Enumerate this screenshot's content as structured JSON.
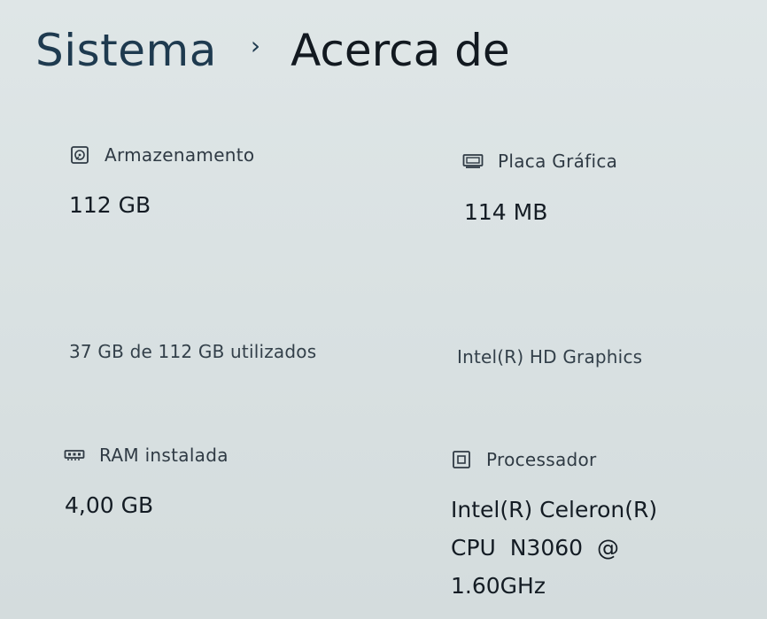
{
  "breadcrumb": {
    "parent": "Sistema",
    "separator": "›",
    "current": "Acerca de"
  },
  "cards": {
    "storage": {
      "icon": "storage-icon",
      "label": "Armazenamento",
      "value": "112 GB",
      "detail": "37 GB de 112 GB utilizados"
    },
    "graphics": {
      "icon": "graphics-card-icon",
      "label": "Placa Gráfica",
      "value": "114 MB",
      "detail": "Intel(R) HD Graphics"
    },
    "ram": {
      "icon": "memory-icon",
      "label": "RAM instalada",
      "value": "4,00 GB"
    },
    "processor": {
      "icon": "processor-icon",
      "label": "Processador",
      "value_lines": [
        "Intel(R) Celeron(R)",
        "CPU  N3060  @",
        "1.60GHz"
      ]
    }
  },
  "colors": {
    "background": "#dbe3e4",
    "title_parent": "#1e3a4f",
    "text": "#141c24"
  }
}
